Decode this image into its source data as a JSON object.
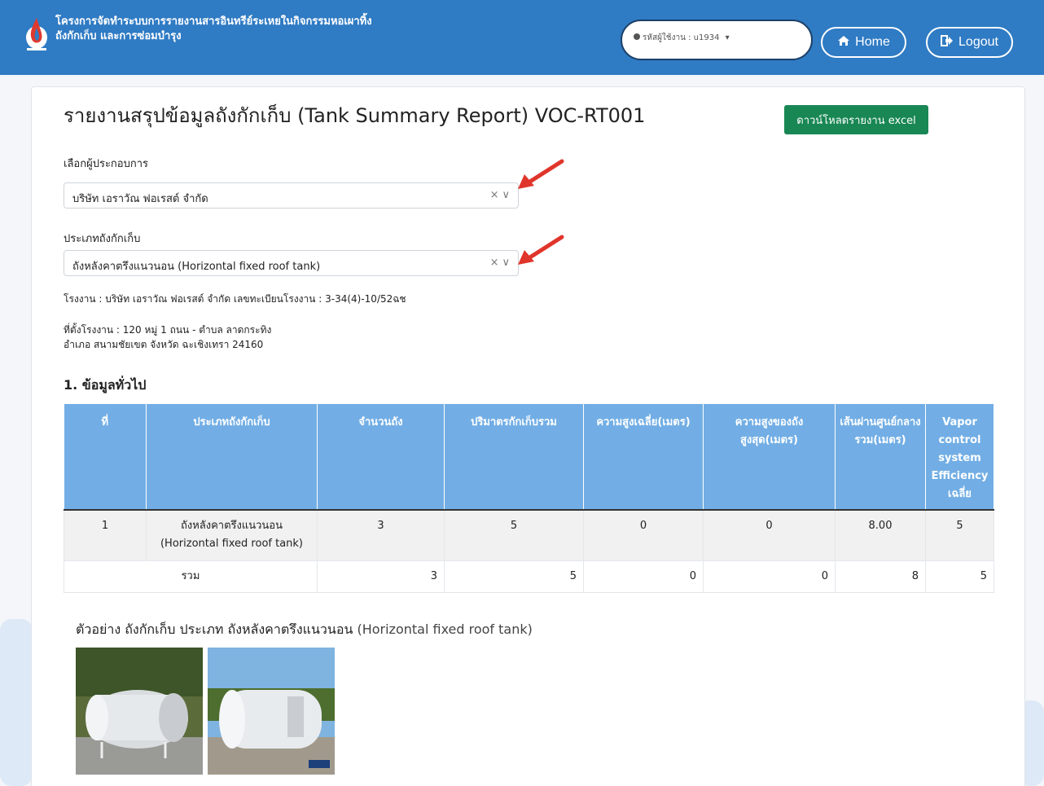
{
  "header": {
    "title_line1": "โครงการจัดทำระบบการรายงานสารอินทรีย์ระเหยในกิจกรรมหอเผาทิ้ง",
    "title_line2": "ถังกักเก็บ และการซ่อมบำรุง",
    "user_label": "รหัสผู้ใช้งาน : u1934",
    "home_label": "Home",
    "logout_label": "Logout"
  },
  "page": {
    "title": "รายงานสรุปข้อมูลถังกักเก็บ (Tank Summary Report) VOC-RT001",
    "excel_button": "ดาวน์โหลดรายงาน excel"
  },
  "form": {
    "operator_label": "เลือกผู้ประกอบการ",
    "operator_value": "บริษัท เอราวัณ ฟอเรสต์ จำกัด",
    "tank_type_label": "ประเภทถังกักเก็บ",
    "tank_type_value": "ถังหลังคาตรึงแนวนอน (Horizontal fixed roof tank)",
    "clear_icon": "×",
    "chevron_icon": "⌄"
  },
  "factory": {
    "line1": "โรงงาน : บริษัท เอราวัณ ฟอเรสต์ จำกัด เลขทะเบียนโรงงาน : 3-34(4)-10/52ฉช",
    "address1": "ที่ตั้งโรงงาน : 120 หมู่ 1 ถนน - ตำบล ลาดกระทิง",
    "address2": "อำเภอ สนามชัยเขต จังหวัด ฉะเชิงเทรา 24160"
  },
  "section1": {
    "title": "1. ข้อมูลทั่วไป",
    "headers": [
      "ที่",
      "ประเภทถังกักเก็บ",
      "จำนวนถัง",
      "ปริมาตรกักเก็บรวม",
      "ความสูงเฉลี่ย(เมตร)",
      "ความสูงของถังสูงสุด(เมตร)",
      "เส้นผ่านศูนย์กลางรวม(เมตร)",
      "Vapor control system Efficiency เฉลี่ย"
    ],
    "row": {
      "no": "1",
      "type_th": "ถังหลังคาตรึงแนวนอน",
      "type_en": "(Horizontal fixed roof tank)",
      "count": "3",
      "volume": "5",
      "avg_height": "0",
      "max_height": "0",
      "diameter": "8.00",
      "efficiency": "5"
    },
    "total": {
      "label": "รวม",
      "count": "3",
      "volume": "5",
      "avg_height": "0",
      "max_height": "0",
      "diameter": "8",
      "efficiency": "5"
    }
  },
  "example": {
    "title_th": "ตัวอย่าง ถังกักเก็บ ประเภท ถังหลังคาตรึงแนวนอน",
    "title_en": " (Horizontal fixed roof tank)"
  }
}
